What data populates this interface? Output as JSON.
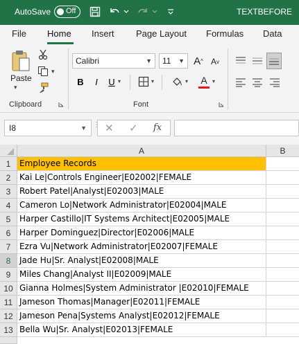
{
  "titlebar": {
    "autosave_label": "AutoSave",
    "autosave_state": "Off",
    "filename": "TEXTBEFORE"
  },
  "tabs": [
    {
      "label": "File"
    },
    {
      "label": "Home"
    },
    {
      "label": "Insert"
    },
    {
      "label": "Page Layout"
    },
    {
      "label": "Formulas"
    },
    {
      "label": "Data"
    }
  ],
  "ribbon": {
    "clipboard_label": "Clipboard",
    "paste_label": "Paste",
    "font_label": "Font",
    "font_name": "Calibri",
    "font_size": "11",
    "colors": {
      "accent": "#217346",
      "font_color": "#e81123",
      "header_fill": "#ffc000"
    }
  },
  "formula_bar": {
    "name_box": "I8",
    "fx_label": "fx",
    "content": ""
  },
  "columns": [
    "A",
    "B"
  ],
  "rows": [
    {
      "num": "1",
      "a": "Employee Records"
    },
    {
      "num": "2",
      "a": "Kai Le|Controls Engineer|E02002|FEMALE"
    },
    {
      "num": "3",
      "a": "Robert Patel|Analyst|E02003|MALE"
    },
    {
      "num": "4",
      "a": "Cameron Lo|Network Administrator|E02004|MALE"
    },
    {
      "num": "5",
      "a": "Harper Castillo|IT Systems Architect|E02005|MALE"
    },
    {
      "num": "6",
      "a": "Harper Dominguez|Director|E02006|MALE"
    },
    {
      "num": "7",
      "a": "Ezra Vu|Network Administrator|E02007|FEMALE"
    },
    {
      "num": "8",
      "a": "Jade Hu|Sr. Analyst|E02008|MALE"
    },
    {
      "num": "9",
      "a": "Miles Chang|Analyst II|E02009|MALE"
    },
    {
      "num": "10",
      "a": "Gianna Holmes|System Administrator |E02010|FEMALE"
    },
    {
      "num": "11",
      "a": "Jameson Thomas|Manager|E02011|FEMALE"
    },
    {
      "num": "12",
      "a": "Jameson Pena|Systems Analyst|E02012|FEMALE"
    },
    {
      "num": "13",
      "a": "Bella Wu|Sr. Analyst|E02013|FEMALE"
    }
  ]
}
